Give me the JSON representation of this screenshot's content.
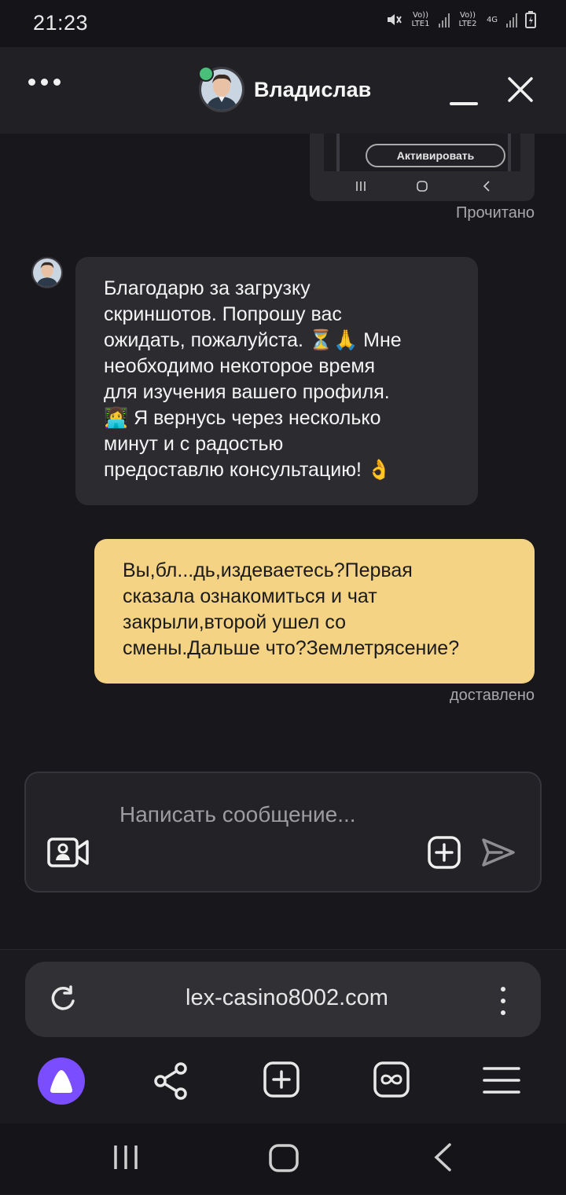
{
  "status_bar": {
    "time": "21:23",
    "sim1_label": "Vo)) LTE1",
    "sim2_label": "Vo)) LTE2",
    "network_label": "4G",
    "icons": [
      "mute-icon",
      "signal-icon",
      "signal-icon",
      "data-arrows-icon",
      "battery-icon"
    ]
  },
  "header": {
    "contact_name": "Владислав",
    "online": true,
    "icons": [
      "more-dots-icon",
      "minimize-icon",
      "close-icon"
    ]
  },
  "thumbnail": {
    "button_label": "Активировать"
  },
  "messages": [
    {
      "direction": "outgoing",
      "kind": "screenshot",
      "status": "Прочитано"
    },
    {
      "direction": "incoming",
      "text": "Благодарю за загрузку\nскриншотов. Попрошу вас\nожидать, пожалуйста. ⏳🙏 Мне\nнеобходимо некоторое время\nдля изучения вашего профиля.\n👩‍💻 Я вернусь через несколько\nминут и с радостью\nпредоставлю консультацию! 👌"
    },
    {
      "direction": "outgoing",
      "text": "Вы,бл...дь,издеваетесь?Первая\nсказала ознакомиться и чат\nзакрыли,второй ушел со\nсмены.Дальше что?Землетрясение?",
      "status": "доставлено"
    }
  ],
  "composer": {
    "placeholder": "Написать сообщение...",
    "value": ""
  },
  "browser": {
    "url": "lex-casino8002.com",
    "toolbar": [
      "alice-icon",
      "share-icon",
      "new-tab-icon",
      "tabs-icon",
      "menu-icon"
    ]
  },
  "colors": {
    "background": "#18171b",
    "incoming_bubble": "#2c2b30",
    "outgoing_bubble": "#f5d384",
    "online": "#49c07a",
    "alice": "#7a4dff"
  }
}
